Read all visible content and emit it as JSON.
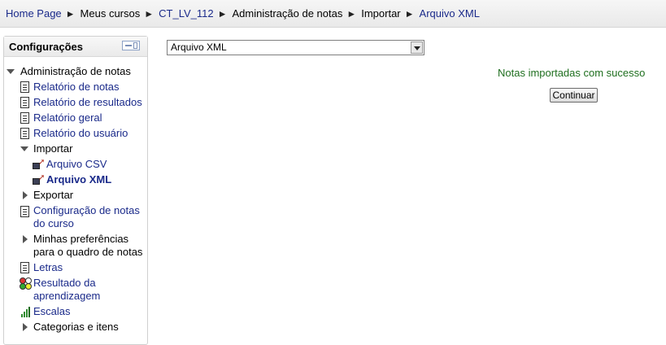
{
  "breadcrumb": {
    "items": [
      "Home Page",
      "Meus cursos",
      "CT_LV_112",
      "Administração de notas",
      "Importar",
      "Arquivo XML"
    ],
    "separator": "►"
  },
  "block": {
    "title": "Configurações",
    "items": {
      "admin": "Administração de notas",
      "relatorio_notas": "Relatório de notas",
      "relatorio_resultados": "Relatório de resultados",
      "relatorio_geral": "Relatório geral",
      "relatorio_usuario": "Relatório do usuário",
      "importar": "Importar",
      "arquivo_csv": "Arquivo CSV",
      "arquivo_xml": "Arquivo XML",
      "exportar": "Exportar",
      "configuracao_line1": "Configuração de notas",
      "configuracao_line2": "do curso",
      "preferencias_line1": "Minhas preferências",
      "preferencias_line2": "para o quadro de notas",
      "letras": "Letras",
      "resultado_line1": "Resultado da",
      "resultado_line2": "aprendizagem",
      "escalas": "Escalas",
      "categorias": "Categorias e itens"
    }
  },
  "main": {
    "select_value": "Arquivo XML",
    "success_message": "Notas importadas com sucesso",
    "continue_label": "Continuar"
  }
}
